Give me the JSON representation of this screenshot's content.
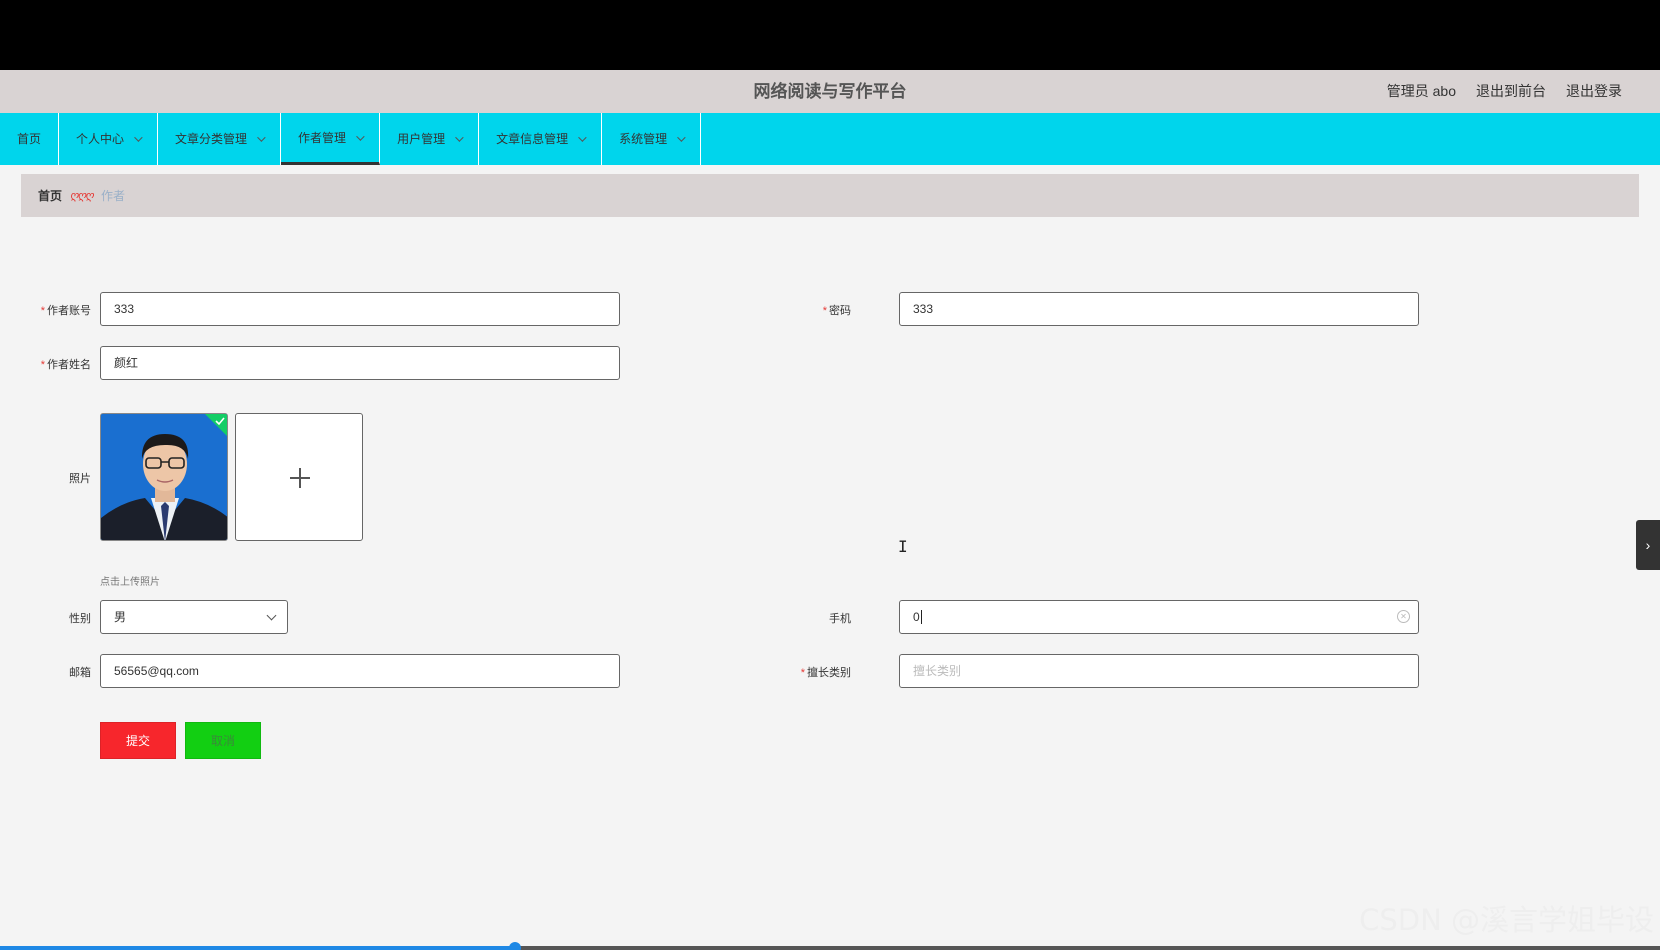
{
  "app": {
    "title": "网络阅读与写作平台",
    "top_links": [
      "管理员 abo",
      "退出到前台",
      "退出登录"
    ]
  },
  "nav": {
    "items": [
      {
        "label": "首页"
      },
      {
        "label": "个人中心"
      },
      {
        "label": "文章分类管理"
      },
      {
        "label": "作者管理"
      },
      {
        "label": "用户管理"
      },
      {
        "label": "文章信息管理"
      },
      {
        "label": "系统管理"
      }
    ],
    "active": "作者管理"
  },
  "breadcrumb": {
    "home": "首页",
    "separator": "ღღღ",
    "current": "作者"
  },
  "form": {
    "account_label": "作者账号",
    "account_value": "333",
    "password_label": "密码",
    "password_value": "333",
    "name_label": "作者姓名",
    "name_value": "颜红",
    "photo_label": "照片",
    "photo_hint": "点击上传照片",
    "gender_label": "性别",
    "gender_value": "男",
    "phone_label": "手机",
    "phone_value": "0",
    "email_label": "邮箱",
    "email_value": "56565@qq.com",
    "specialty_label": "擅长类别",
    "specialty_placeholder": "擅长类别",
    "submit_label": "提交",
    "cancel_label": "取消"
  },
  "video": {
    "progress": 0.31
  },
  "watermark": "CSDN @溪言学姐毕设",
  "colors": {
    "nav_bg": "#00d5ec",
    "header_bg": "#d9d3d3",
    "submit": "#f7262c",
    "cancel": "#12cf12"
  }
}
